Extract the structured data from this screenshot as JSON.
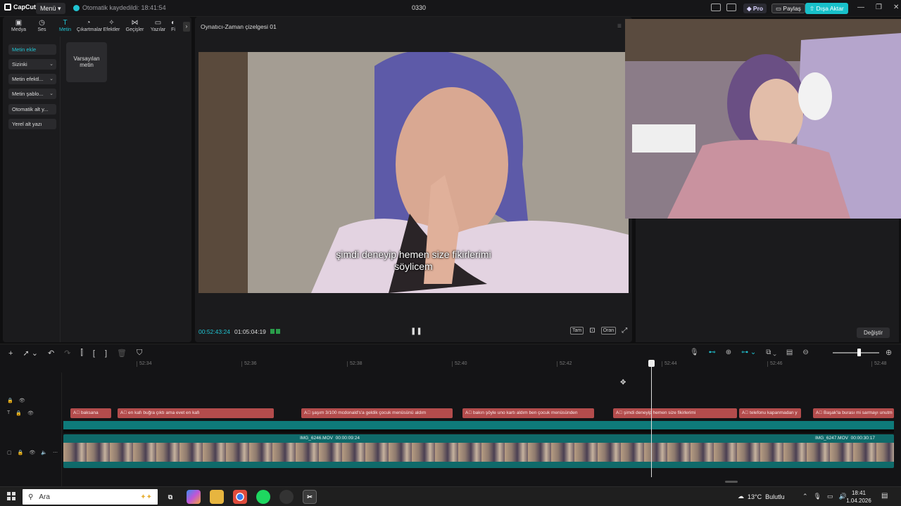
{
  "app": {
    "logo": "CapCut",
    "menu_label": "Menü",
    "save_status": "Otomatik kaydedildi: 18:41:54",
    "project_title": "0330",
    "pro_label": "Pro",
    "share_label": "Paylaş",
    "export_label": "Dışa Aktar"
  },
  "toolbar": {
    "tools": [
      {
        "label": "Medya",
        "icon": "media-icon"
      },
      {
        "label": "Ses",
        "icon": "audio-icon"
      },
      {
        "label": "Metin",
        "icon": "text-icon"
      },
      {
        "label": "Çıkartmalar",
        "icon": "sticker-icon"
      },
      {
        "label": "Efektler",
        "icon": "effects-icon"
      },
      {
        "label": "Geçişler",
        "icon": "transitions-icon"
      },
      {
        "label": "Yazılar",
        "icon": "captions-icon"
      },
      {
        "label": "Fi",
        "icon": "filters-icon"
      }
    ]
  },
  "text_panel": {
    "items": [
      {
        "label": "Metin ekle",
        "has_chevron": false
      },
      {
        "label": "Sizinki",
        "has_chevron": true
      },
      {
        "label": "Metin efektl...",
        "has_chevron": true
      },
      {
        "label": "Metin şablo...",
        "has_chevron": true
      },
      {
        "label": "Otomatik alt y...",
        "has_chevron": false
      },
      {
        "label": "Yerel alt yazı",
        "has_chevron": false
      }
    ],
    "default_card": "Varsayılan metin"
  },
  "player": {
    "title": "Oynatıcı-Zaman çizelgesi 01",
    "subtitle_line1": "şimdi deneyip hemen size fikirlerimi",
    "subtitle_line2": "söylicem",
    "current_time": "00:52:43:24",
    "total_time": "01:05:04:19",
    "full_label": "Tam",
    "ratio_label": "Oran"
  },
  "right_panel": {
    "replace_label": "Değiştir"
  },
  "timeline": {
    "ruler": [
      "52:34",
      "52:36",
      "52:38",
      "52:40",
      "52:42",
      "52:44",
      "52:46",
      "52:48"
    ],
    "subtitles": [
      "baksana",
      "en kafı buğra çıktı ama evet en kafı",
      "şaşım 3/100 mcdonald's'a geldik çocuk menüsünü aldım",
      "bakın şöyle uno kartı aldım ben çocuk menüsünden",
      "şimdi deneyip hemen size fikirlerimi",
      "telefonu kapanmadan y",
      "Başak'la burası mi sarmayı unutm"
    ],
    "clips": [
      {
        "name": "IMG_6246.MOV",
        "duration": "00:00:09:24"
      },
      {
        "name": "IMG_6247.MOV",
        "duration": "00:00:30:17"
      }
    ]
  },
  "taskbar": {
    "search_placeholder": "Ara",
    "weather_temp": "13°C",
    "weather_desc": "Bulutlu",
    "time": "18:41",
    "date": "1.04.2026"
  }
}
